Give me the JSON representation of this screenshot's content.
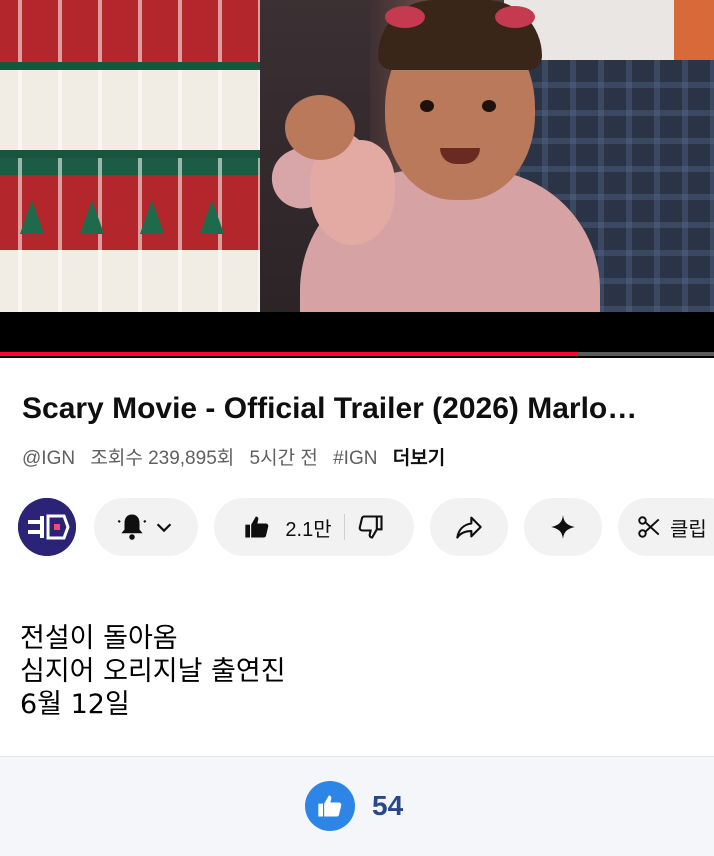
{
  "video": {
    "progress_fraction": 0.81,
    "colors": {
      "progress": "#ff0033",
      "track": "#5a5a5a"
    }
  },
  "title": "Scary Movie - Official Trailer (2026) Marlo…",
  "meta": {
    "channel": "@IGN",
    "views": "조회수 239,895회",
    "time": "5시간 전",
    "hashtag": "#IGN",
    "more": "더보기"
  },
  "actions": {
    "avatar_icon": "ign-logo-avatar",
    "bell_icon": "bell-icon",
    "like_count": "2.1만",
    "share_icon": "share-icon",
    "ask_icon": "sparkle-icon",
    "clip_label": "클립"
  },
  "description": {
    "lines": [
      "전설이 돌아옴",
      "심지어 오리지날 출연진",
      "6월 12일"
    ]
  },
  "footer": {
    "like_count": "54",
    "colors": {
      "like_circle": "#2d86e6",
      "count_text": "#27488a"
    }
  }
}
